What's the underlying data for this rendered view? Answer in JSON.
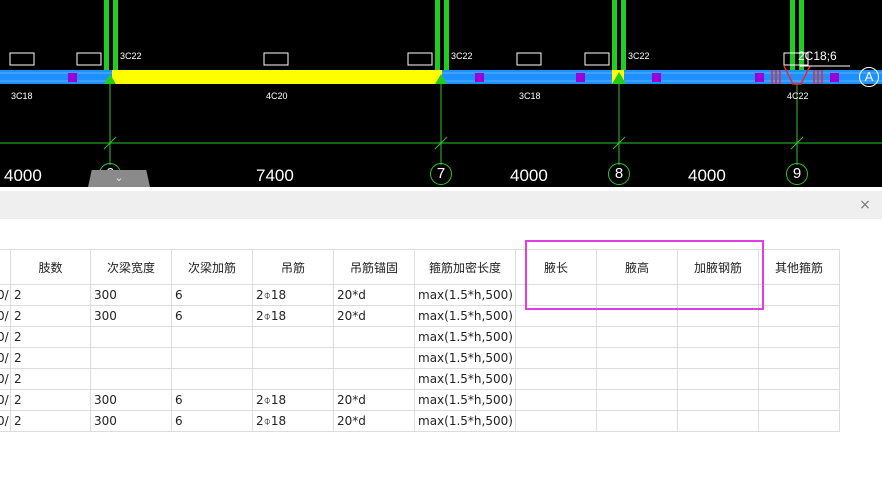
{
  "cad": {
    "top_labels": [
      "3C22",
      "3C22",
      "3C22",
      "2C18;6"
    ],
    "bottom_labels": [
      "3C18",
      "4C20",
      "3C18",
      "4C22"
    ],
    "dimensions": [
      "4000",
      "7400",
      "4000",
      "4000"
    ],
    "axes": [
      "6",
      "7",
      "8",
      "9"
    ],
    "axis_letter": "A",
    "colors": {
      "background": "#000000",
      "beam_yellow": "#ffff00",
      "beam_blue": "#1e90ff",
      "column_green": "#22cc22",
      "axis_line": "#2ec52e",
      "marker_purple": "#9b00d6"
    }
  },
  "panel": {
    "close_icon": "×",
    "collapse_icon": "⌄",
    "columns": [
      "",
      "肢数",
      "次梁宽度",
      "次梁加筋",
      "吊筋",
      "吊筋锚固",
      "箍筋加密长度",
      "腋长",
      "腋高",
      "加腋钢筋",
      "其他箍筋"
    ],
    "rows": [
      [
        "0/",
        "2",
        "300",
        "6",
        "2⌽18",
        "20*d",
        "max(1.5*h,500)",
        "",
        "",
        "",
        ""
      ],
      [
        "0/",
        "2",
        "300",
        "6",
        "2⌽18",
        "20*d",
        "max(1.5*h,500)",
        "",
        "",
        "",
        ""
      ],
      [
        "0/",
        "2",
        "",
        "",
        "",
        "",
        "max(1.5*h,500)",
        "",
        "",
        "",
        ""
      ],
      [
        "0/",
        "2",
        "",
        "",
        "",
        "",
        "max(1.5*h,500)",
        "",
        "",
        "",
        ""
      ],
      [
        "0/",
        "2",
        "",
        "",
        "",
        "",
        "max(1.5*h,500)",
        "",
        "",
        "",
        ""
      ],
      [
        "0/",
        "2",
        "300",
        "6",
        "2⌽18",
        "20*d",
        "max(1.5*h,500)",
        "",
        "",
        "",
        ""
      ],
      [
        "0/",
        "2",
        "300",
        "6",
        "2⌽18",
        "20*d",
        "max(1.5*h,500)",
        "",
        "",
        "",
        ""
      ]
    ],
    "highlight_color": "#e23de2"
  }
}
